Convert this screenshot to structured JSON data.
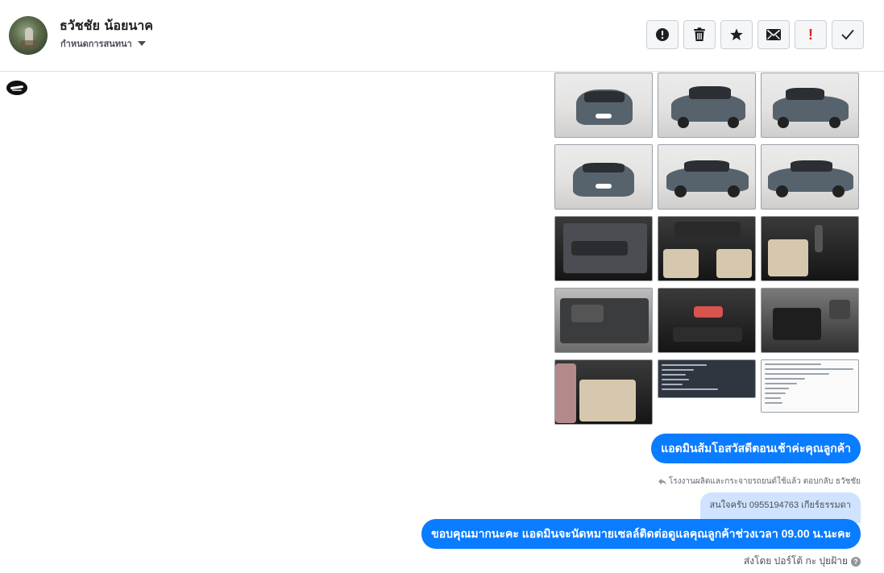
{
  "conversation": {
    "contact_name": "ธวัชชัย น้อยนาค",
    "subtitle": "กำหนดการสนทนา"
  },
  "toolbar": [
    {
      "icon": "alert-circle-icon",
      "name": "report-button"
    },
    {
      "icon": "trash-icon",
      "name": "delete-button"
    },
    {
      "icon": "star-icon",
      "name": "star-button"
    },
    {
      "icon": "envelope-icon",
      "name": "mark-unread-button"
    },
    {
      "icon": "exclamation-icon",
      "name": "follow-up-button",
      "glyph": "!"
    },
    {
      "icon": "checkmark-icon",
      "name": "mark-done-button"
    }
  ],
  "attachments": {
    "images": [
      {
        "content": "car-front"
      },
      {
        "content": "car-front-angle"
      },
      {
        "content": "car-rear-angle"
      },
      {
        "content": "car-rear"
      },
      {
        "content": "car-side"
      },
      {
        "content": "car-side-front"
      },
      {
        "content": "door-interior"
      },
      {
        "content": "dashboard"
      },
      {
        "content": "gear-shift"
      },
      {
        "content": "engine-bay"
      },
      {
        "content": "center-console"
      },
      {
        "content": "engine-detail"
      },
      {
        "content": "rear-seat"
      },
      {
        "content": "document-dark"
      },
      {
        "content": "document-post"
      }
    ]
  },
  "messages": {
    "greeting": "แอดมินส้มโอสวัสดีตอนเช้าค่ะคุณลูกค้า",
    "reply_meta": "โรงงานผลิตและกระจายรถยนต์ใช้แล้ว ตอบกลับ ธวัชชัย",
    "quoted": "สนใจครับ 0955194763 เกียร์ธรรมดา",
    "reply": "ขอบคุณมากนะคะ แอดมินจะนัดหมายเซลล์ติดต่อดูแลคุณลูกค้าช่วงเวลา 09.00 น.นะคะ",
    "sent_by": "ส่งโดย ปอร์โต้ กะ ปุยฝ้าย"
  },
  "colors": {
    "bubble_blue": "#0a7cff",
    "quoted_bg": "#cfe3ff",
    "alert_red": "#e41e1e"
  }
}
